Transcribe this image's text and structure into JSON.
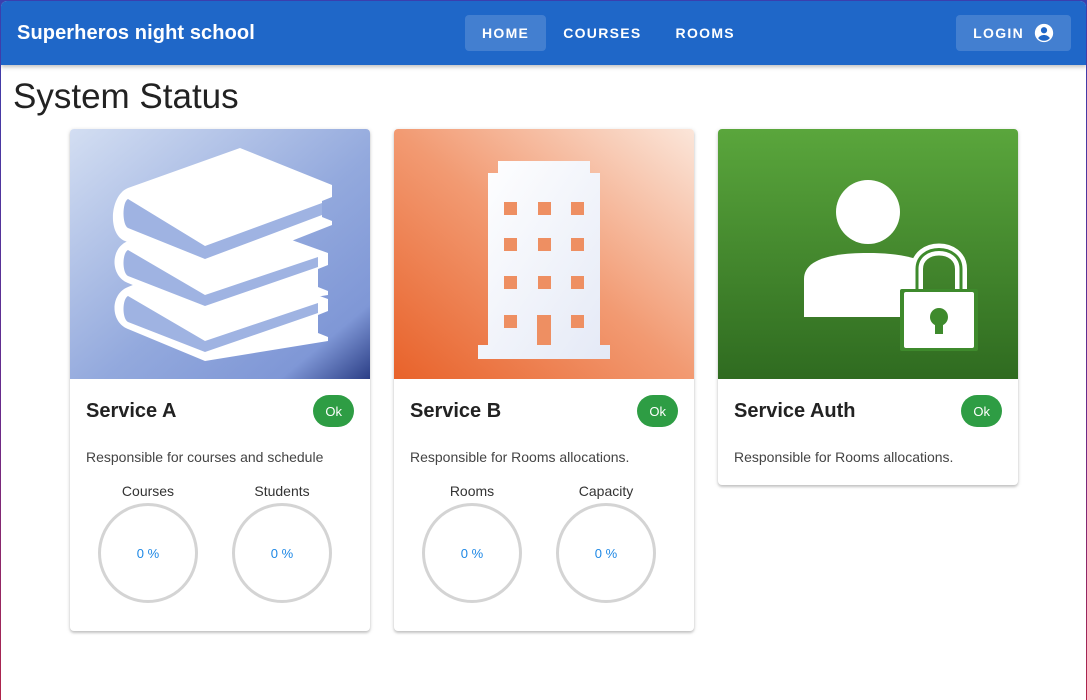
{
  "app": {
    "title": "Superheros night school"
  },
  "nav": {
    "items": [
      {
        "label": "HOME"
      },
      {
        "label": "COURSES"
      },
      {
        "label": "ROOMS"
      }
    ]
  },
  "login": {
    "label": "LOGIN",
    "icon": "account-circle-icon"
  },
  "page": {
    "title": "System Status"
  },
  "cards": [
    {
      "name": "Service A",
      "status": "Ok",
      "description": "Responsible for courses and schedule",
      "icon": "books-icon",
      "gauges": [
        {
          "label": "Courses",
          "value": "0 %"
        },
        {
          "label": "Students",
          "value": "0 %"
        }
      ]
    },
    {
      "name": "Service B",
      "status": "Ok",
      "description": "Responsible for Rooms allocations.",
      "icon": "building-icon",
      "gauges": [
        {
          "label": "Rooms",
          "value": "0 %"
        },
        {
          "label": "Capacity",
          "value": "0 %"
        }
      ]
    },
    {
      "name": "Service Auth",
      "status": "Ok",
      "description": "Responsible for Rooms allocations.",
      "icon": "user-lock-icon",
      "gauges": []
    }
  ],
  "colors": {
    "appbar": "#1f67c8",
    "status_ok": "#2e9d44",
    "gauge_text": "#1e88e5"
  }
}
